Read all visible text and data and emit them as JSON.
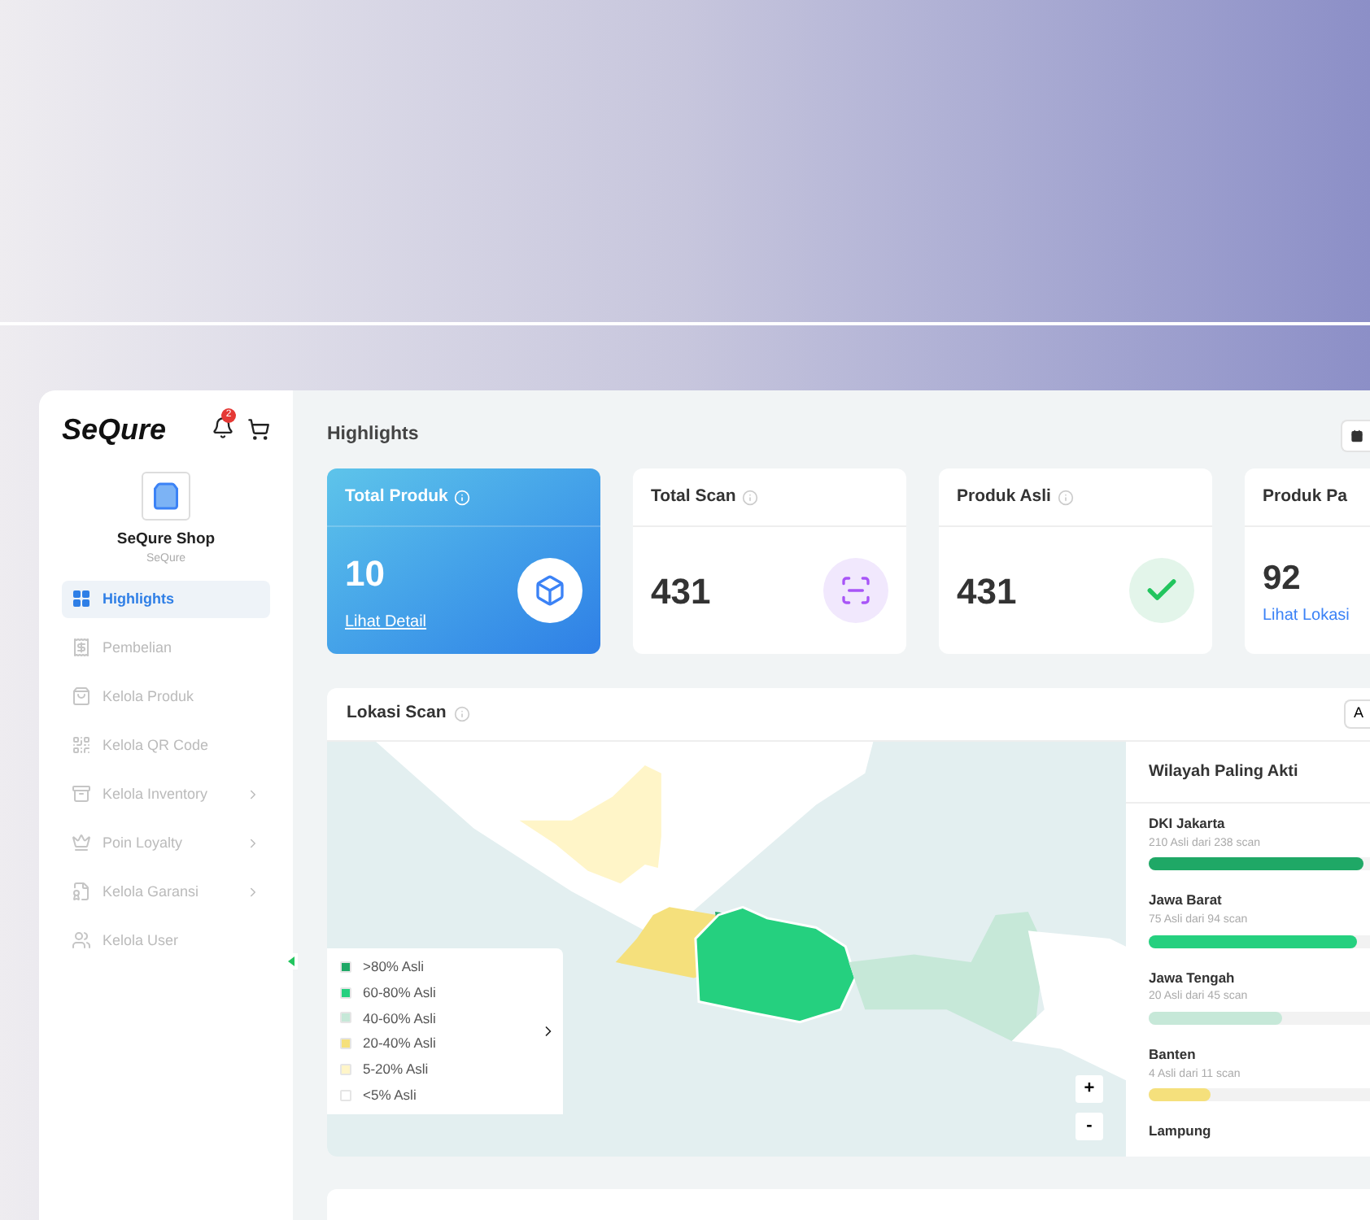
{
  "sidebar": {
    "logo": "SeQure",
    "notification_count": "2",
    "shop": {
      "name": "SeQure Shop",
      "subtitle": "SeQure"
    },
    "items": [
      {
        "label": "Highlights",
        "selected": true,
        "submenu": false
      },
      {
        "label": "Pembelian",
        "selected": false,
        "submenu": false
      },
      {
        "label": "Kelola Produk",
        "selected": false,
        "submenu": false
      },
      {
        "label": "Kelola QR Code",
        "selected": false,
        "submenu": false
      },
      {
        "label": "Kelola Inventory",
        "selected": false,
        "submenu": true
      },
      {
        "label": "Poin Loyalty",
        "selected": false,
        "submenu": true
      },
      {
        "label": "Kelola Garansi",
        "selected": false,
        "submenu": true
      },
      {
        "label": "Kelola User",
        "selected": false,
        "submenu": false
      }
    ]
  },
  "header": {
    "title": "Highlights"
  },
  "stat_cards": [
    {
      "kind": "primary",
      "title": "Total Produk",
      "value": "10",
      "link": "Lihat Detail"
    },
    {
      "kind": "scan",
      "title": "Total Scan",
      "value": "431"
    },
    {
      "kind": "check",
      "title": "Produk Asli",
      "value": "431"
    },
    {
      "kind": "plain",
      "title": "Produk Pa",
      "value": "92",
      "link": "Lihat Lokasi"
    }
  ],
  "map_panel": {
    "title": "Lokasi Scan",
    "filter_button": "A",
    "legend": [
      {
        "label": ">80% Asli",
        "color": "#1fa866"
      },
      {
        "label": "60-80% Asli",
        "color": "#25d07f"
      },
      {
        "label": "40-60% Asli",
        "color": "#c6e8d8"
      },
      {
        "label": "20-40% Asli",
        "color": "#f5e07c"
      },
      {
        "label": "5-20% Asli",
        "color": "#fff5c8"
      },
      {
        "label": "<5% Asli",
        "color": "#ffffff"
      }
    ],
    "zoom_in": "+",
    "zoom_out": "-",
    "regions_panel": {
      "title": "Wilayah Paling Akti",
      "regions": [
        {
          "name": "DKI Jakarta",
          "detail": "210 Asli dari 238 scan",
          "level": 0.97,
          "color": "#1fa866"
        },
        {
          "name": "Jawa Barat",
          "detail": "75 Asli dari 94 scan",
          "level": 0.94,
          "color": "#25d07f"
        },
        {
          "name": "Jawa Tengah",
          "detail": "20 Asli dari 45 scan",
          "level": 0.6,
          "color": "#c6e8d8"
        },
        {
          "name": "Banten",
          "detail": "4 Asli dari 11 scan",
          "level": 0.28,
          "color": "#f5e07c"
        },
        {
          "name": "Lampung"
        }
      ]
    }
  }
}
